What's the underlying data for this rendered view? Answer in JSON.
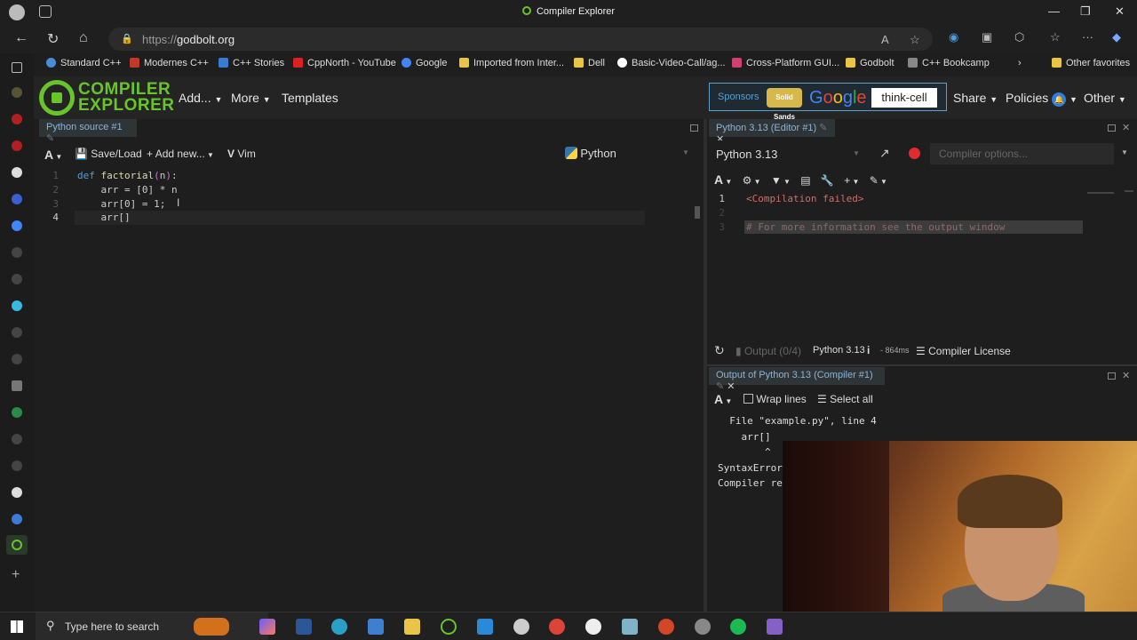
{
  "browser": {
    "window_title": "Compiler Explorer",
    "url_protocol": "https://",
    "url_host": "godbolt.org"
  },
  "bookmarks": [
    {
      "label": "Standard C++",
      "color": "#4a8cd8"
    },
    {
      "label": "Modernes C++",
      "color": "#c0392b"
    },
    {
      "label": "C++ Stories",
      "color": "#3a7bd5"
    },
    {
      "label": "CppNorth - YouTube",
      "color": "#e02020"
    },
    {
      "label": "Google",
      "color": "#4285f4"
    },
    {
      "label": "Imported from Inter...",
      "color": "#e8c547"
    },
    {
      "label": "Dell",
      "color": "#e8c547"
    },
    {
      "label": "Basic-Video-Call/ag...",
      "color": "#ffffff"
    },
    {
      "label": "Cross-Platform GUI...",
      "color": "#d04070"
    },
    {
      "label": "Godbolt",
      "color": "#e8c547"
    },
    {
      "label": "C++ Bookcamp",
      "color": "#888888"
    },
    {
      "label": "Other favorites",
      "color": "#e8c547"
    }
  ],
  "ce_header": {
    "logo_line1": "COMPILER",
    "logo_line2": "EXPLORER",
    "menu_add": "Add...",
    "menu_more": "More",
    "menu_templates": "Templates",
    "sponsors_label": "Sponsors",
    "sponsor_solid": "Solid Sands",
    "sponsor_google": "Google",
    "sponsor_thinkcell": "think-cell",
    "menu_share": "Share",
    "menu_policies": "Policies",
    "menu_other": "Other"
  },
  "editor": {
    "tab_title": "Python source #1",
    "save_load": "Save/Load",
    "add_new": "Add new...",
    "vim": "Vim",
    "language": "Python",
    "lines": [
      {
        "num": "1",
        "text": "def factorial(n):"
      },
      {
        "num": "2",
        "text": "    arr = [0] * n"
      },
      {
        "num": "3",
        "text": "    arr[0] = 1;"
      },
      {
        "num": "4",
        "text": "    arr[]"
      }
    ]
  },
  "compiler": {
    "tab_title": "Python 3.13 (Editor #1)",
    "compiler_name": "Python 3.13",
    "options_placeholder": "Compiler options...",
    "asm_lines": [
      {
        "num": "1",
        "text": "<Compilation failed>"
      },
      {
        "num": "2",
        "text": ""
      },
      {
        "num": "3",
        "text": "# For more information see the output window"
      }
    ],
    "footer_output": "Output (0/4)",
    "footer_compiler": "Python 3.13",
    "footer_time": "- 864ms",
    "footer_license": "Compiler License"
  },
  "output": {
    "tab_title": "Output of Python 3.13 (Compiler #1)",
    "wrap_lines": "Wrap lines",
    "select_all": "Select all",
    "lines": [
      "  File \"example.py\", line 4",
      "    arr[]",
      "        ^",
      "SyntaxError",
      "Compiler re"
    ]
  },
  "taskbar": {
    "search_placeholder": "Type here to search"
  }
}
